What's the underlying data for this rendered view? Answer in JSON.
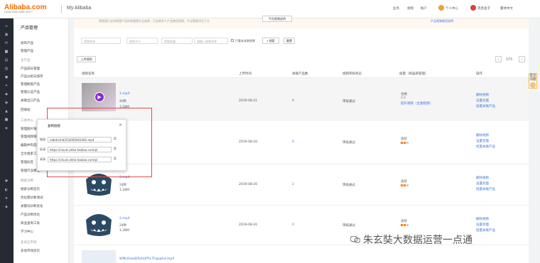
{
  "header": {
    "logo": "Alibaba.com",
    "logo_tag": "Global trade starts here™",
    "title": "My Alibaba",
    "nav": [
      "业务",
      "视频",
      "帐户"
    ],
    "account_center": "个人中心",
    "messages": "消息盒子",
    "language": "繁体中文"
  },
  "menu": {
    "heading": "产品管理",
    "items": [
      "发布产品",
      "管理产品"
    ],
    "group1": "主产品",
    "items2": [
      "产品成长管理",
      "产品分组与排序",
      "管理橱窗产品",
      "管理认证产品",
      "关联出口产品",
      "回收站"
    ],
    "group2": "工具中心",
    "items3": [
      "管理图片银行",
      "管理视频银行",
      "编辑并布度提升",
      "全文搜索工具",
      "管理标签",
      "管理行业模板"
    ],
    "group3": "搜索诊断",
    "items4": [
      "搜索诊断首页",
      "优化需诊断测试",
      "关键词诊断优化",
      "产品诊断优化",
      "商品查询工具",
      "学习中心"
    ],
    "group4": "多语言市场",
    "items5": [
      "多语市场首页"
    ]
  },
  "banner": {
    "text": "视频银行支持视频产品的质量提升品效果，可关联多个产品使用视频。行业管理详见下方",
    "button": "平台视频说明",
    "right_link": "产品视频使用说明"
  },
  "filters": {
    "status": "视频状态",
    "size": "视频大小",
    "quality": "视频质量",
    "name_ph": "请输入视频名称",
    "checkbox": "只看未关联视频",
    "search": "搜索",
    "reset": "重置"
  },
  "toolbar": {
    "upload": "上传视频",
    "page": "1/75"
  },
  "columns": [
    "视频名称",
    "上传时间",
    "关联产品数",
    "视频审核状态",
    "质量（则画质管理）",
    "操作"
  ],
  "rows": [
    {
      "name": "1.mp4",
      "dur": "40秒",
      "size": "3.28M",
      "date": "2019-08-21",
      "count": "0",
      "status": "审核通过",
      "quality": "合格",
      "qlink": "提升视频（主图视频）",
      "ops": [
        "删除视频",
        "设置封面",
        "批量关联产品"
      ]
    },
    {
      "name": "",
      "dur": "",
      "size": "",
      "date": "2019-08-20",
      "count": "0",
      "status": "审核通过",
      "quality": "良好",
      "qlink": "",
      "ops": [
        "删除视频",
        "设置封面",
        "批量关联产品"
      ]
    },
    {
      "name": "2.mp4",
      "dur": "24秒",
      "size": "1.28M",
      "date": "2019-08-20",
      "count": "2",
      "status": "审核通过",
      "quality": "良好",
      "qlink": "",
      "ops": [
        "删除视频",
        "设置封面",
        "批量关联产品"
      ]
    },
    {
      "name": "2.mp4",
      "dur": "24秒",
      "size": "1.28M",
      "date": "2019-08-20",
      "count": "0",
      "status": "审核通过",
      "quality": "良好",
      "qlink": "",
      "ops": [
        "删除视频",
        "设置封面",
        "批量关联产品"
      ]
    }
  ],
  "last_row_name": "WML0eaaDRshUP5L7E@@hd.mp4",
  "popup": {
    "title": "复制链接",
    "close": "×",
    "labels": [
      "链接",
      "标清",
      "高清"
    ],
    "values": [
      "/alb/t/c/hd/254005603492.mp4",
      "https://cloud.video.taobao.com/pl",
      "https://cloud.video.taobao.com/pl"
    ]
  },
  "help_tab": "常见问题",
  "watermark": "朱玄奘大数据运营一点通",
  "colors": {
    "accent": "#ff6a00",
    "link": "#3c76d6",
    "highlight": "#e24a4a"
  }
}
